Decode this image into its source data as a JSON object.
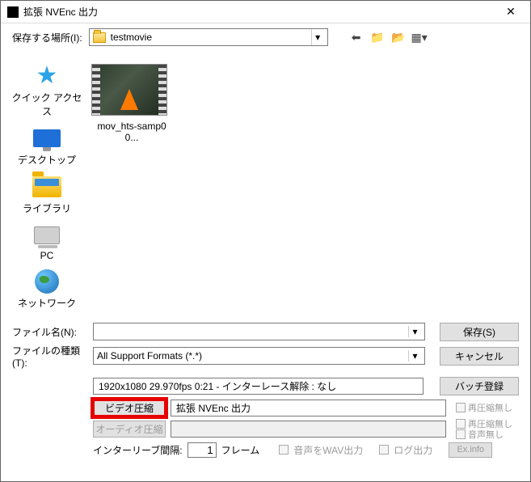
{
  "window": {
    "title": "拡張 NVEnc 出力"
  },
  "toolbar": {
    "save_location_label": "保存する場所(I):",
    "current_folder": "testmovie"
  },
  "sidebar": {
    "items": [
      {
        "label": "クイック アクセス"
      },
      {
        "label": "デスクトップ"
      },
      {
        "label": "ライブラリ"
      },
      {
        "label": "PC"
      },
      {
        "label": "ネットワーク"
      }
    ]
  },
  "file_area": {
    "files": [
      {
        "name": "mov_hts-samp00..."
      }
    ]
  },
  "form": {
    "filename_label": "ファイル名(N):",
    "filename_value": "",
    "filetype_label": "ファイルの種類(T):",
    "filetype_value": "All Support Formats (*.*)",
    "save_btn": "保存(S)",
    "cancel_btn": "キャンセル",
    "info_line": "1920x1080  29.970fps  0:21  -  インターレース解除 : なし",
    "batch_btn": "バッチ登録",
    "video_compress_btn": "ビデオ圧縮",
    "video_compress_value": "拡張 NVEnc 出力",
    "audio_compress_btn": "オーディオ圧縮",
    "audio_compress_value": "",
    "no_recompress_label": "再圧縮無し",
    "no_audio_label": "音声無し",
    "interleave_label": "インターリーブ間隔:",
    "interleave_value": "1",
    "interleave_unit": "フレーム",
    "wav_out_label": "音声をWAV出力",
    "log_out_label": "ログ出力",
    "exinfo_btn": "Ex.info"
  }
}
